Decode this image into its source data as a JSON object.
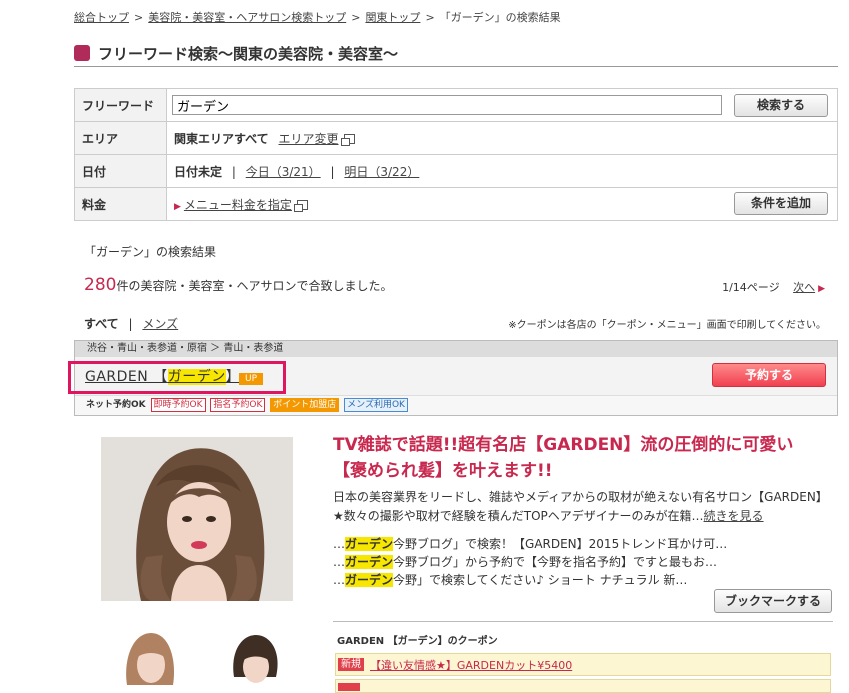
{
  "breadcrumb": [
    "総合トップ",
    "美容院・美容室・ヘアサロン検索トップ",
    "関東トップ",
    "「ガーデン」の検索結果"
  ],
  "breadcrumb_sep": ">",
  "page_title": "フリーワード検索～関東の美容院・美容室～",
  "search": {
    "keyword_label": "フリーワード",
    "keyword_value": "ガーデン",
    "search_button": "検索する",
    "area_label": "エリア",
    "area_value": "関東エリアすべて",
    "area_change": "エリア変更",
    "date_label": "日付",
    "date_value": "日付未定",
    "date_sep": "|",
    "today": "今日（3/21）",
    "tomorrow": "明日（3/22）",
    "price_label": "料金",
    "price_link": "メニュー料金を指定",
    "add_condition": "条件を追加"
  },
  "results": {
    "heading": "「ガーデン」の検索結果",
    "count": "280",
    "count_suffix": "件の美容院・美容室・ヘアサロンで合致しました。",
    "page_info": "1/14ページ",
    "next": "次へ",
    "filter_all": "すべて",
    "filter_sep": "|",
    "filter_mens": "メンズ",
    "note": "※クーポンは各店の「クーポン・メニュー」画面で印刷してください。"
  },
  "listing": {
    "location": "渋谷・青山・表参道・原宿 ＞ 青山・表参道",
    "name_prefix": "GARDEN 【",
    "name_highlight": "ガーデン",
    "name_suffix": "】",
    "up_badge": "UP",
    "reserve_button": "予約する",
    "net_label": "ネット予約OK",
    "tags": [
      "即時予約OK",
      "指名予約OK",
      "ポイント加盟店",
      "メンズ利用OK"
    ],
    "headline": "TV雑誌で話題!!超有名店【GARDEN】流の圧倒的に可愛い【褒められ髪】を叶えます!!",
    "description": "日本の美容業界をリードし、雑誌やメディアからの取材が絶えない有名サロン【GARDEN】★数々の撮影や取材で経験を積んだTOPヘアデザイナーのみが在籍…",
    "read_more": "続きを見る",
    "blogs": [
      {
        "pre": "…",
        "hl": "ガーデン",
        "post": "今野ブログ」で検索！【GARDEN】2015トレンド耳かけ可…"
      },
      {
        "pre": "…",
        "hl": "ガーデン",
        "post": "今野ブログ」から予約で【今野を指名予約】ですと最もお…"
      },
      {
        "pre": "…",
        "hl": "ガーデン",
        "post": "今野」で検索してください♪ ショート ナチュラル 新…"
      }
    ],
    "bookmark_button": "ブックマークする",
    "coupon_title": "GARDEN 【ガーデン】のクーポン",
    "coupon_new": "新規",
    "coupon_text": "【違い友情感★】GARDENカット¥5400"
  },
  "colors": {
    "accent": "#c8284e",
    "highlight": "#f7e600",
    "box": "#e0155f"
  }
}
